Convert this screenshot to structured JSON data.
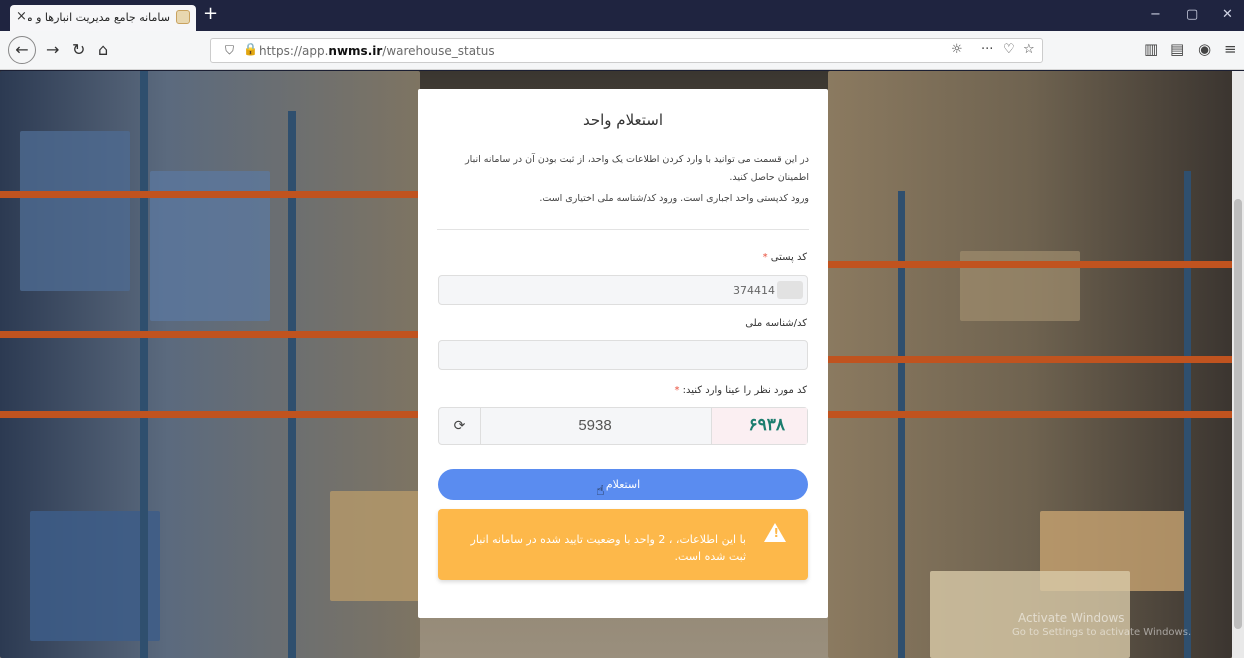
{
  "browser": {
    "tab_title": "سامانه جامع مدیریت انبارها و مرا",
    "tab_close": "×",
    "new_tab": "+",
    "url_prefix": "https://app.",
    "url_domain": "nwms.ir",
    "url_path": "/warehouse_status",
    "window_controls": {
      "minimize": "−",
      "maximize": "▢",
      "close": "✕"
    }
  },
  "form": {
    "title": "استعلام واحد",
    "description": "در این قسمت می توانید با وارد کردن اطلاعات یک واحد، از ثبت بودن آن در سامانه انبار اطمینان حاصل کنید.",
    "note": "ورود کدپستی واحد اجباری است. ورود کد/شناسه ملی اختیاری است.",
    "postal_code_label": "کد پستی",
    "postal_code_value": "374414",
    "national_id_label": "کد/شناسه ملی",
    "national_id_value": "",
    "captcha_label": "کد مورد نظر را عینا وارد کنید:",
    "required_mark": "*",
    "captcha_image_text": "۶۹۳۸",
    "captcha_value": "5938",
    "submit_label": "استعلام"
  },
  "alert": {
    "message": "با این اطلاعات، ، 2 واحد با وضعیت تایید شده در سامانه انبار ثبت شده است."
  },
  "watermark": {
    "line1": "Activate Windows",
    "line2": "Go to Settings to activate Windows."
  },
  "colors": {
    "submit": "#5a8cf0",
    "alert": "#fdb84a",
    "required": "#e94f3c"
  }
}
